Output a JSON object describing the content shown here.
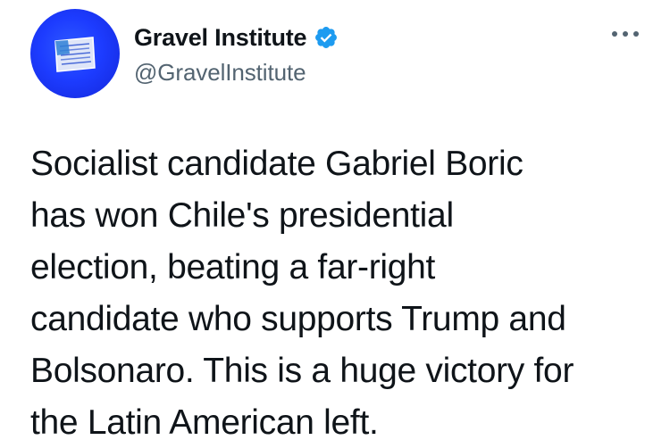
{
  "author": {
    "display_name": "Gravel Institute",
    "handle": "@GravelInstitute",
    "verified": true,
    "avatar_icon": "gravel-institute-logo-icon",
    "avatar_color": "#1d3cff"
  },
  "actions": {
    "more_icon": "more-options-icon"
  },
  "tweet": {
    "lines": [
      "Socialist candidate Gabriel Boric",
      "has won Chile's presidential",
      "election, beating a far-right",
      "candidate who supports Trump and",
      "Bolsonaro. This is a huge victory for",
      "the Latin American left."
    ]
  },
  "colors": {
    "text_primary": "#0f1419",
    "text_secondary": "#536471",
    "verified_blue": "#1d9bf0"
  }
}
